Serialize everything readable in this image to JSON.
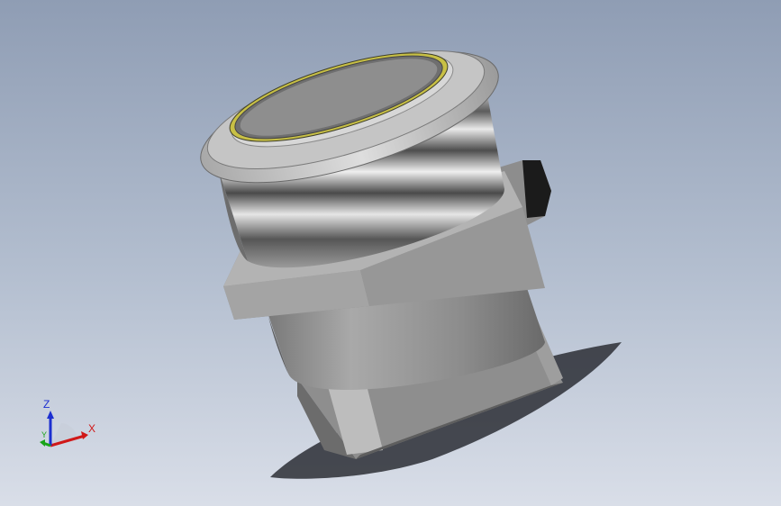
{
  "viewport": {
    "background_top": "#8f9db4",
    "background_bottom": "#d9dee8"
  },
  "part": {
    "name_icon": "push-button-switch-model",
    "body_color": "#8a8a8a",
    "ring_color": "#c8c8c8",
    "led_ring_color": "#c9c24a",
    "face_color": "#6f6f6f"
  },
  "triad": {
    "x_label": "X",
    "y_label": "Y",
    "z_label": "Z",
    "x_color": "#d01818",
    "y_color": "#19a319",
    "z_color": "#1c2fd0"
  }
}
